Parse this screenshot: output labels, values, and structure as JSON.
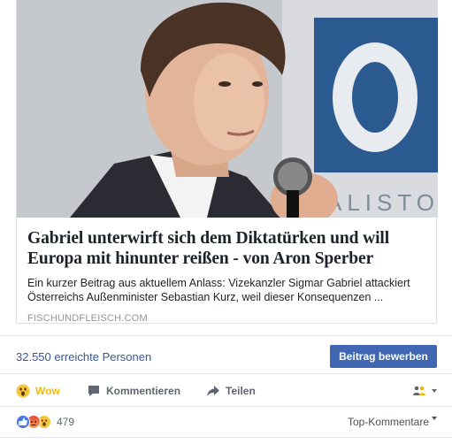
{
  "link_preview": {
    "title": "Gabriel unterwirft sich dem Diktatürken und will Europa mit hinunter reißen - von Aron Sperber",
    "description": "Ein kurzer Beitrag aus aktuellem Anlass: Vizekanzler Sigmar Gabriel attackiert Österreichs Außenminister Sebastian Kurz, weil dieser Konsequenzen ...",
    "domain": "FISCHUNDFLEISCH.COM",
    "image_icon": "man-with-microphone-photo"
  },
  "reach": {
    "text": "32.550 erreichte Personen",
    "promote_label": "Beitrag bewerben"
  },
  "actions": {
    "wow_label": "Wow",
    "comment_label": "Kommentieren",
    "share_label": "Teilen",
    "wow_icon": "wow-face-icon",
    "comment_icon": "speech-bubble-icon",
    "share_icon": "share-arrow-icon",
    "audience_icon": "friends-audience-icon"
  },
  "reactions": {
    "count": "479",
    "icons": [
      "like-icon",
      "angry-icon",
      "wow-icon"
    ],
    "sort_label": "Top-Kommentare"
  },
  "colors": {
    "link_blue": "#365899",
    "button_blue": "#4267b2",
    "wow_yellow": "#f0ba15",
    "muted_gray": "#90949c",
    "action_gray": "#606770"
  }
}
